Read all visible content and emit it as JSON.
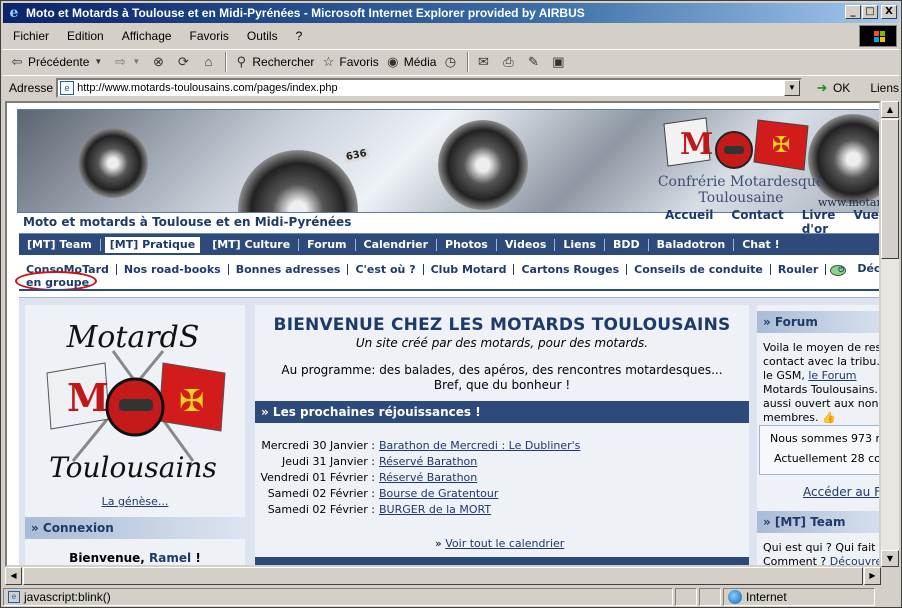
{
  "window": {
    "title": "Moto et Motards à Toulouse et en Midi-Pyrénées - Microsoft Internet Explorer provided by AIRBUS",
    "controls": [
      "_",
      "□",
      "X"
    ]
  },
  "menu": [
    "Fichier",
    "Edition",
    "Affichage",
    "Favoris",
    "Outils",
    "?"
  ],
  "toolbar": {
    "back": "Précédente",
    "search": "Rechercher",
    "favorites": "Favoris",
    "media": "Média"
  },
  "address": {
    "label": "Adresse",
    "url": "http://www.motards-toulousains.com/pages/index.php",
    "ok": "OK",
    "links": "Liens"
  },
  "banner": {
    "brand_line1": "Confrérie Motardesque",
    "brand_line2": "Toulousaine",
    "url_fragment": "www.motard",
    "bike_badge": "636"
  },
  "site": {
    "subtitle": "Moto et motards à Toulouse et en Midi-Pyrénées",
    "top_links": [
      "Accueil",
      "Contact",
      "Livre d'or",
      "Vue"
    ],
    "nav": [
      "[MT] Team",
      "[MT] Pratique",
      "[MT] Culture",
      "Forum",
      "Calendrier",
      "Photos",
      "Videos",
      "Liens",
      "BDD",
      "Baladotron",
      "Chat !"
    ],
    "nav_active_index": 1,
    "subnav": [
      "ConsoMoTard",
      "Nos road-books",
      "Bonnes adresses",
      "C'est où ?",
      "Club Motard",
      "Cartons Rouges",
      "Conseils de conduite",
      "Rouler"
    ],
    "subnav_wrap": "en groupe",
    "logout": "Déconnexion"
  },
  "left": {
    "logo_top": "MotardS",
    "logo_bottom": "Toulousains",
    "genese": "La génèse...",
    "connexion": "» Connexion",
    "welcome_prefix": "Bienvenue,",
    "user": "Ramel",
    "welcome_suffix": "!"
  },
  "center": {
    "title": "BIENVENUE CHEZ LES MOTARDS TOULOUSAINS",
    "subtitle": "Un site créé par des motards, pour des motards.",
    "program_line1": "Au programme: des balades, des apéros, des rencontres motardesques...",
    "program_line2": "Bref, que du bonheur !",
    "events_head": "» Les prochaines réjouissances !",
    "events": [
      {
        "date": "Mercredi 30 Janvier :",
        "label": "Barathon de Mercredi : Le Dubliner's"
      },
      {
        "date": "Jeudi 31 Janvier :",
        "label": "Réservé Barathon"
      },
      {
        "date": "Vendredi 01 Février :",
        "label": "Réservé Barathon"
      },
      {
        "date": "Samedi 02 Février :",
        "label": "Bourse de Gratentour"
      },
      {
        "date": "Samedi 02 Février :",
        "label": "BURGER de la MORT"
      }
    ],
    "calendar_prefix": "»",
    "calendar_link": "Voir tout le calendrier"
  },
  "right": {
    "forum_head": "» Forum",
    "forum_lines": [
      "Voila le moyen de res",
      "contact avec la tribu...",
      "le GSM, "
    ],
    "forum_link": "le Forum",
    "forum_lines2": [
      "Motards Toulousains.",
      "aussi ouvert aux non-",
      "membres."
    ],
    "members_line1": "Nous sommes 973 m",
    "members_line2": "Actuellement 28 con",
    "acceder": "Accéder au For",
    "team_head": "» [MT] Team",
    "team_line1": "Qui est qui ? Qui fait c",
    "team_line2_prefix": "Comment ? ",
    "team_link": "Découvre"
  },
  "status": {
    "text": "javascript:blink()",
    "zone": "Internet"
  }
}
